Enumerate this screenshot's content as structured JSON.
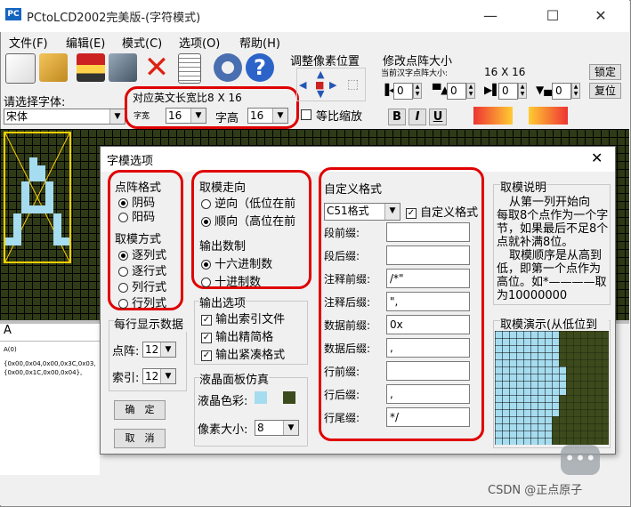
{
  "window": {
    "title": "PCtoLCD2002完美版-(字符模式)",
    "app_icon_text": "PC",
    "controls": {
      "minimize": "—",
      "maximize": "☐",
      "close": "✕"
    }
  },
  "menu": [
    "文件(F)",
    "编辑(E)",
    "模式(C)",
    "选项(O)",
    "帮助(H)"
  ],
  "font": {
    "label": "请选择字体:",
    "value": "宋体",
    "en_ratio_label": "对应英文长宽比8 X 16",
    "width_label": "字宽",
    "width_value": "16",
    "height_label": "字高",
    "height_value": "16",
    "proportional_label": "等比缩放"
  },
  "adjust": {
    "title": "调整像素位置"
  },
  "resize": {
    "title": "修改点阵大小",
    "current_label": "当前汉字点阵大小:",
    "current_value": "16 X 16",
    "lock_label": "锁定",
    "restore_label": "复位",
    "steppers": [
      "0",
      "0",
      "0",
      "0"
    ]
  },
  "style_buttons": [
    "B",
    "I",
    "U"
  ],
  "preview": {
    "char": "A"
  },
  "output_text": {
    "line1": "A(0)",
    "line2": "{0x00,0x04,0x00,0x3C,0x03,",
    "line3": "{0x00,0x1C,0x00,0x04},"
  },
  "dialog": {
    "title": "字模选项",
    "close": "✕",
    "dot_format": {
      "title": "点阵格式",
      "options": [
        "阴码",
        "阳码"
      ],
      "selected": 0
    },
    "scan_mode": {
      "title": "取模方式",
      "options": [
        "逐列式",
        "逐行式",
        "列行式",
        "行列式"
      ],
      "selected": 0
    },
    "direction": {
      "title": "取模走向",
      "options": [
        "逆向（低位在前",
        "顺向（高位在前"
      ],
      "selected": 1
    },
    "number_format": {
      "title": "输出数制",
      "options": [
        "十六进制数",
        "十进制数"
      ],
      "selected": 0
    },
    "output_options": {
      "title": "输出选项",
      "options": [
        "输出索引文件",
        "输出精简格",
        "输出紧凑格式"
      ],
      "checked": [
        true,
        true,
        true
      ]
    },
    "per_line": {
      "title": "每行显示数据",
      "dots_label": "点阵:",
      "dots_value": "12",
      "index_label": "索引:",
      "index_value": "12"
    },
    "lcd": {
      "title": "液晶面板仿真",
      "color_label": "液晶色彩:",
      "pixel_label": "像素大小:",
      "pixel_value": "8",
      "colors": {
        "light": "#a6dcef",
        "dark": "#3c4a1c"
      }
    },
    "ok_label": "确　定",
    "cancel_label": "取　消",
    "custom": {
      "title": "自定义格式",
      "format_value": "C51格式",
      "custom_check_label": "自定义格式",
      "fields": [
        {
          "label": "段前缀:",
          "value": ""
        },
        {
          "label": "段后缀:",
          "value": ""
        },
        {
          "label": "注释前缀:",
          "value": "/*\""
        },
        {
          "label": "注释后缀:",
          "value": "\","
        },
        {
          "label": "数据前缀:",
          "value": "0x"
        },
        {
          "label": "数据后缀:",
          "value": ","
        },
        {
          "label": "行前缀:",
          "value": ""
        },
        {
          "label": "行后缀:",
          "value": ","
        },
        {
          "label": "行尾缀:",
          "value": "*/"
        }
      ]
    },
    "explain": {
      "title": "取模说明",
      "lines": [
        "从第一列开始向",
        "每取8个点作为一个字",
        "节，如果最后不足8个",
        "点就补满8位。",
        "取模顺序是从高到",
        "低，即第一个点作为",
        "高位。如*————取",
        "为10000000"
      ]
    },
    "demo": {
      "title": "取模演示(从低位到"
    }
  },
  "watermark": "CSDN @正点原子",
  "colors": {
    "red_highlight": "#e00000",
    "lcd_dark": "#2f3a17",
    "lcd_light": "#a6dcef"
  }
}
